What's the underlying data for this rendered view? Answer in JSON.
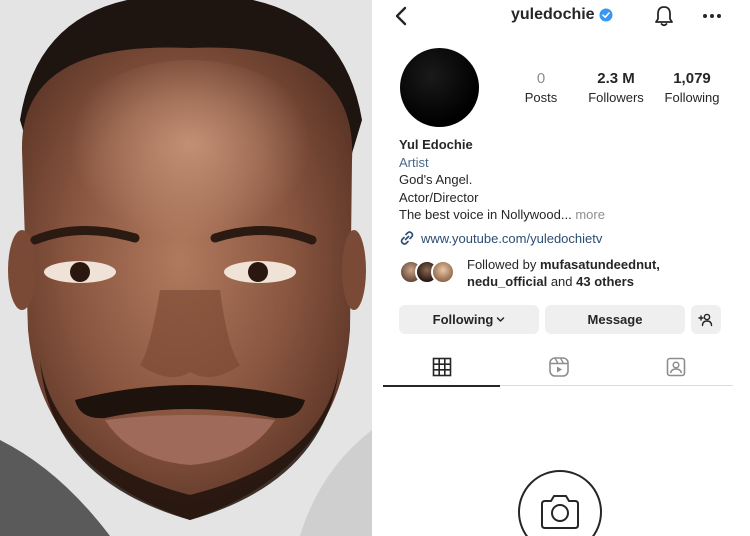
{
  "profile": {
    "username": "yuledochie",
    "stats": {
      "posts": {
        "value": "0",
        "label": "Posts"
      },
      "followers": {
        "value": "2.3 M",
        "label": "Followers"
      },
      "following": {
        "value": "1,079",
        "label": "Following"
      }
    },
    "bio": {
      "name": "Yul Edochie",
      "category": "Artist",
      "line1": "God's Angel.",
      "line2": "Actor/Director",
      "line3": "The best voice in Nollywood...",
      "more": "more"
    },
    "link": "www.youtube.com/yuledochietv",
    "followed_by": {
      "prefix": "Followed by",
      "user1": "mufasatundeednut,",
      "user2": "nedu_official",
      "and": "and",
      "others": "43 others"
    }
  },
  "actions": {
    "following": "Following",
    "message": "Message"
  },
  "icons": {
    "back": "chevron-left-icon",
    "verified": "verified-badge-icon",
    "bell": "bell-icon",
    "more": "more-dots-icon",
    "link": "link-icon",
    "add_user": "add-user-icon",
    "grid": "grid-icon",
    "reels": "reels-icon",
    "tagged": "tagged-icon",
    "camera": "camera-icon"
  },
  "colors": {
    "verified": "#3897f0",
    "link": "#2b4d73",
    "category": "#4a6a8a",
    "button_bg": "#efefef"
  }
}
